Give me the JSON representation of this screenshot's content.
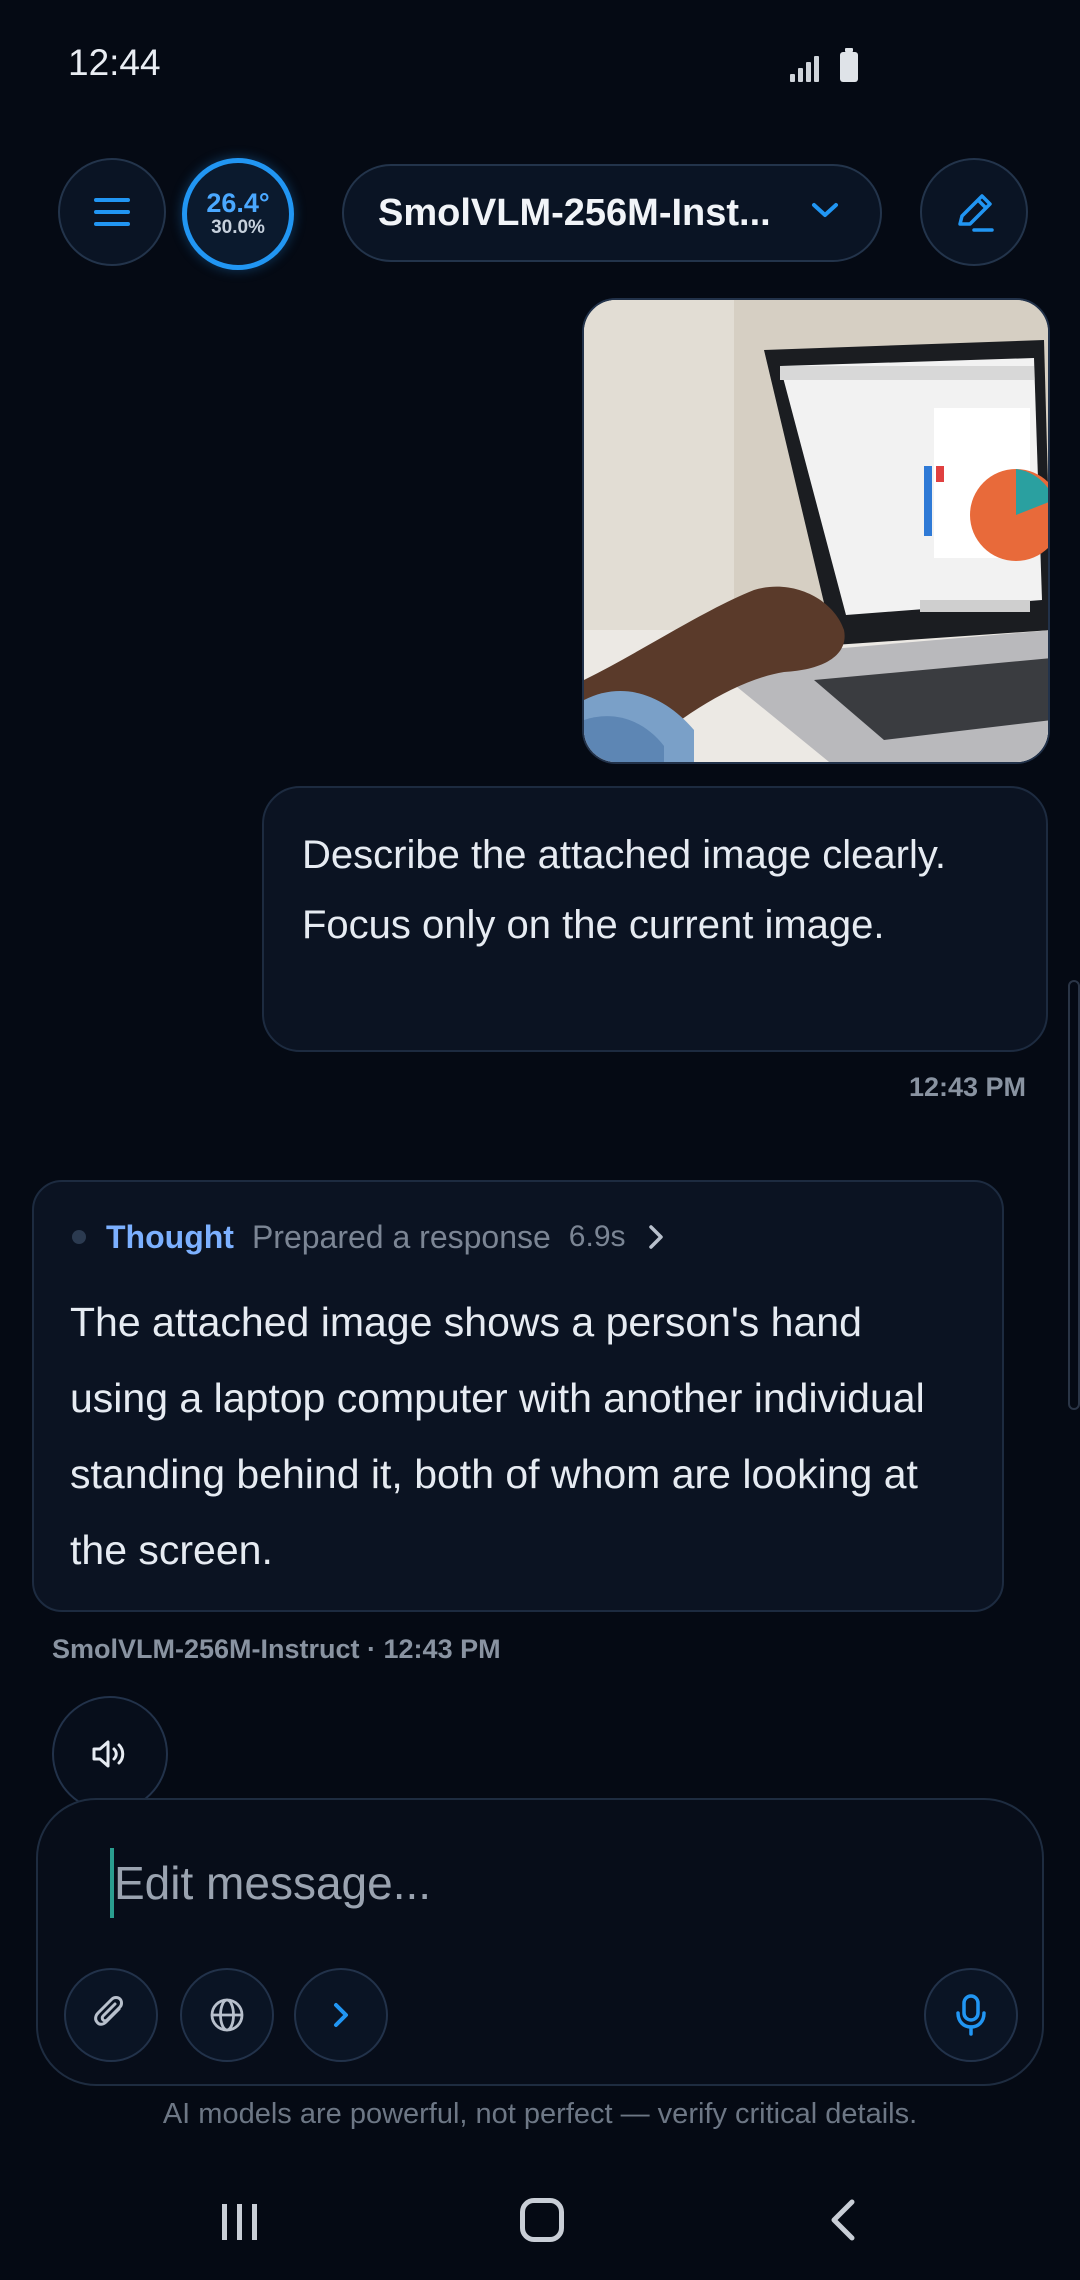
{
  "status_bar": {
    "time": "12:44"
  },
  "header": {
    "temperature": "26.4°",
    "usage": "30.0%",
    "model_name": "SmolVLM-256M-Inst..."
  },
  "chat": {
    "user_message": {
      "text": "Describe the attached image clearly. Focus only on the current image.",
      "time": "12:43 PM"
    },
    "ai_message": {
      "thought_label": "Thought",
      "thought_status": "Prepared a response",
      "thought_time": "6.9s",
      "text": "The attached image shows a person's hand using a laptop computer with another individual standing behind it, both of whom are looking at the screen.",
      "meta": "SmolVLM-256M-Instruct · 12:43 PM"
    }
  },
  "composer": {
    "placeholder": "Edit message..."
  },
  "disclaimer": "AI models are powerful, not perfect — verify critical details.",
  "colors": {
    "accent": "#2196f3",
    "background": "#050a14",
    "thought_label": "#7cb0ff"
  }
}
